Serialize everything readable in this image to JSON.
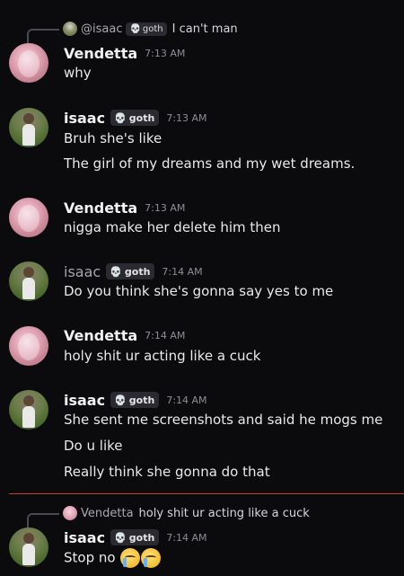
{
  "tag_label": "goth",
  "reply1": {
    "author": "@isaac",
    "text": "I can't man"
  },
  "messages": [
    {
      "author": "Vendetta",
      "time": "7:13 AM",
      "lines": [
        "why"
      ]
    },
    {
      "author": "isaac",
      "time": "7:13 AM",
      "lines": [
        "Bruh she's like",
        "The girl of my dreams and my wet dreams."
      ]
    },
    {
      "author": "Vendetta",
      "time": "7:13 AM",
      "lines": [
        "nigga make her delete him then"
      ]
    },
    {
      "author": "isaac",
      "time": "7:14 AM",
      "lines": [
        "Do you think she's gonna say yes to me"
      ]
    },
    {
      "author": "Vendetta",
      "time": "7:14 AM",
      "lines": [
        "holy shit ur acting like a cuck"
      ]
    },
    {
      "author": "isaac",
      "time": "7:14 AM",
      "lines": [
        "She sent me screenshots and said he mogs me",
        "Do u like",
        "Really think she gonna do that"
      ]
    },
    {
      "author": "isaac",
      "time": "7:14 AM",
      "lines": [
        "Stop no"
      ]
    }
  ],
  "reply2": {
    "author": "Vendetta",
    "text": "holy shit ur acting like a cuck"
  }
}
